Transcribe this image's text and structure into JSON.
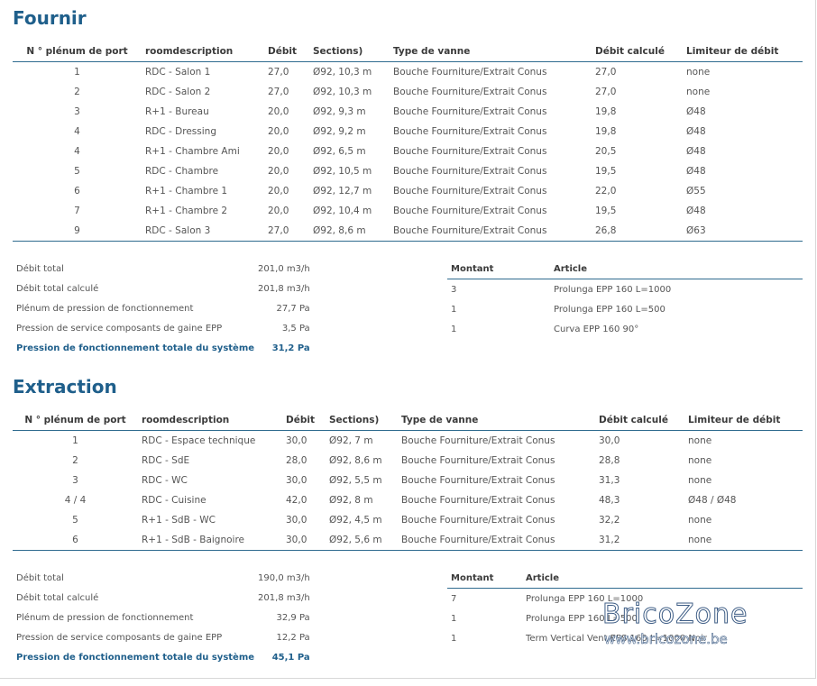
{
  "sections": [
    {
      "title": "Fournir",
      "columns": [
        "N ° plénum de port",
        "roomdescription",
        "Débit",
        "Sections)",
        "Type de vanne",
        "Débit calculé",
        "Limiteur de débit"
      ],
      "rows": [
        [
          "1",
          "RDC - Salon 1",
          "27,0",
          "Ø92, 10,3 m",
          "Bouche Fourniture/Extrait Conus",
          "27,0",
          "none"
        ],
        [
          "2",
          "RDC - Salon 2",
          "27,0",
          "Ø92, 10,3 m",
          "Bouche Fourniture/Extrait Conus",
          "27,0",
          "none"
        ],
        [
          "3",
          "R+1 - Bureau",
          "20,0",
          "Ø92, 9,3 m",
          "Bouche Fourniture/Extrait Conus",
          "19,8",
          "Ø48"
        ],
        [
          "4",
          "RDC - Dressing",
          "20,0",
          "Ø92, 9,2 m",
          "Bouche Fourniture/Extrait Conus",
          "19,8",
          "Ø48"
        ],
        [
          "4",
          "R+1 - Chambre Ami",
          "20,0",
          "Ø92, 6,5 m",
          "Bouche Fourniture/Extrait Conus",
          "20,5",
          "Ø48"
        ],
        [
          "5",
          "RDC - Chambre",
          "20,0",
          "Ø92, 10,5 m",
          "Bouche Fourniture/Extrait Conus",
          "19,5",
          "Ø48"
        ],
        [
          "6",
          "R+1 - Chambre 1",
          "20,0",
          "Ø92, 12,7 m",
          "Bouche Fourniture/Extrait Conus",
          "22,0",
          "Ø55"
        ],
        [
          "7",
          "R+1 - Chambre 2",
          "20,0",
          "Ø92, 10,4 m",
          "Bouche Fourniture/Extrait Conus",
          "19,5",
          "Ø48"
        ],
        [
          "9",
          "RDC - Salon 3",
          "27,0",
          "Ø92, 8,6 m",
          "Bouche Fourniture/Extrait Conus",
          "26,8",
          "Ø63"
        ]
      ],
      "summary": [
        [
          "Débit total",
          "201,0 m3/h"
        ],
        [
          "Débit total calculé",
          "201,8 m3/h"
        ],
        [
          "Plénum de pression de fonctionnement",
          "27,7 Pa"
        ],
        [
          "Pression de service composants de gaine EPP",
          "3,5 Pa"
        ],
        [
          "Pression de fonctionnement totale du système",
          "31,2 Pa"
        ]
      ],
      "articles_header": [
        "Montant",
        "Article"
      ],
      "articles": [
        [
          "3",
          "Prolunga EPP 160 L=1000"
        ],
        [
          "1",
          "Prolunga EPP 160 L=500"
        ],
        [
          "1",
          "Curva EPP 160 90°"
        ]
      ]
    },
    {
      "title": "Extraction",
      "columns": [
        "N ° plénum de port",
        "roomdescription",
        "Débit",
        "Sections)",
        "Type de vanne",
        "Débit calculé",
        "Limiteur de débit"
      ],
      "rows": [
        [
          "1",
          "RDC - Espace technique",
          "30,0",
          "Ø92, 7 m",
          "Bouche Fourniture/Extrait Conus",
          "30,0",
          "none"
        ],
        [
          "2",
          "RDC - SdE",
          "28,0",
          "Ø92, 8,6 m",
          "Bouche Fourniture/Extrait Conus",
          "28,8",
          "none"
        ],
        [
          "3",
          "RDC - WC",
          "30,0",
          "Ø92, 5,5 m",
          "Bouche Fourniture/Extrait Conus",
          "31,3",
          "none"
        ],
        [
          "4  /  4",
          "RDC - Cuisine",
          "42,0",
          "Ø92, 8 m",
          "Bouche Fourniture/Extrait Conus",
          "48,3",
          "Ø48  /  Ø48"
        ],
        [
          "5",
          "R+1 - SdB - WC",
          "30,0",
          "Ø92, 4,5 m",
          "Bouche Fourniture/Extrait Conus",
          "32,2",
          "none"
        ],
        [
          "6",
          "R+1 - SdB - Baignoire",
          "30,0",
          "Ø92, 5,6 m",
          "Bouche Fourniture/Extrait Conus",
          "31,2",
          "none"
        ]
      ],
      "summary": [
        [
          "Débit total",
          "190,0 m3/h"
        ],
        [
          "Débit total calculé",
          "201,8 m3/h"
        ],
        [
          "Plénum de pression de fonctionnement",
          "32,9 Pa"
        ],
        [
          "Pression de service composants de gaine EPP",
          "12,2 Pa"
        ],
        [
          "Pression de fonctionnement totale du système",
          "45,1 Pa"
        ]
      ],
      "articles_header": [
        "Montant",
        "Article"
      ],
      "articles": [
        [
          "7",
          "Prolunga EPP 160 L=1000"
        ],
        [
          "1",
          "Prolunga EPP 160 L=500"
        ],
        [
          "1",
          "Term Vertical Vent EPS 160 L=1000 Noir"
        ]
      ]
    }
  ],
  "watermark": {
    "logo": "BricoZone",
    "url": "www.bricozone.be"
  }
}
